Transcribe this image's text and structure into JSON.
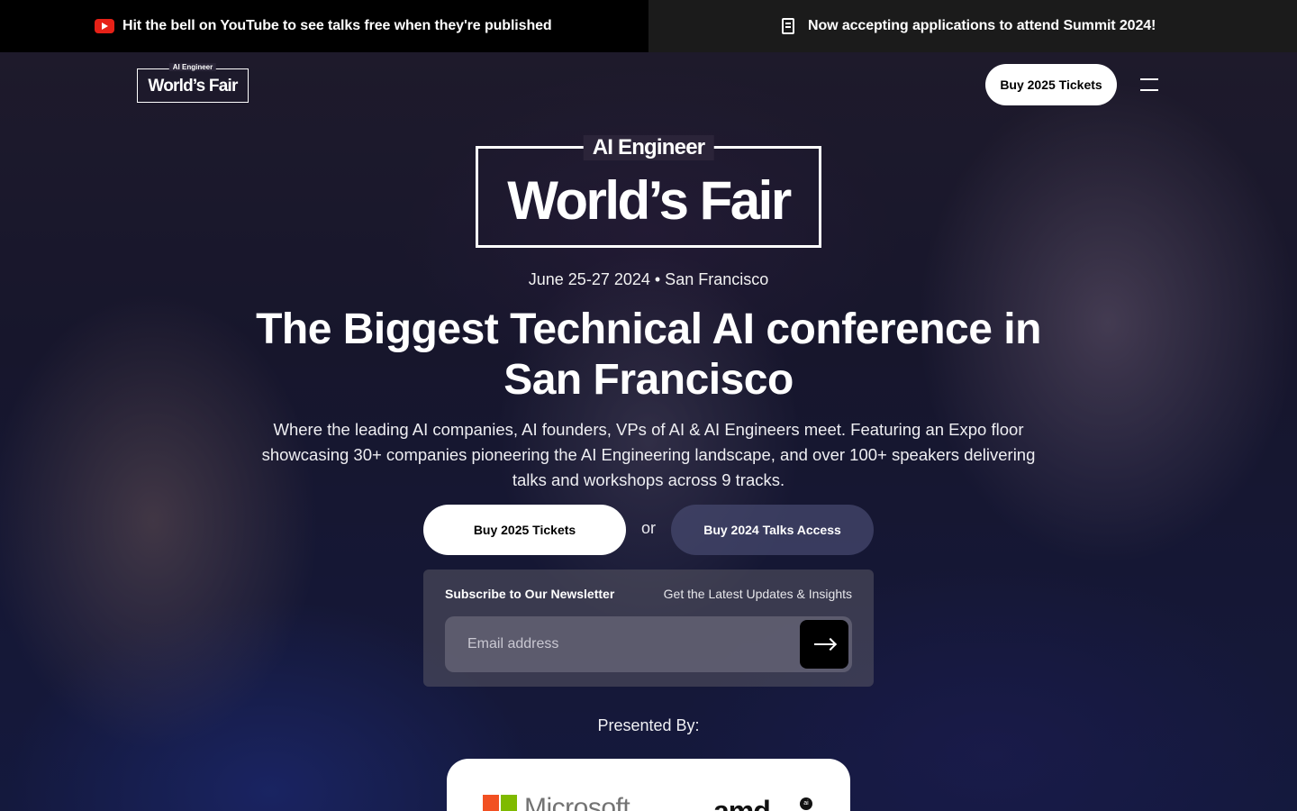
{
  "announcements": {
    "left_text": "Hit the bell on YouTube to see talks free when they're published",
    "left_icon": "youtube-icon",
    "right_text": "Now accepting applications to attend Summit 2024!",
    "right_icon": "application-icon"
  },
  "nav": {
    "logo_small": "AI Engineer",
    "logo_big": "World’s Fair",
    "buy_button": "Buy 2025 Tickets",
    "menu_icon": "hamburger-menu-icon"
  },
  "hero": {
    "logo_small": "AI Engineer",
    "logo_big": "World’s Fair",
    "dateline": "June 25-27 2024 • San Francisco",
    "headline": "The Biggest Technical AI conference in San Francisco",
    "subtext": "Where the leading AI companies, AI founders, VPs of AI & AI Engineers meet. Featuring an Expo floor showcasing 30+ companies pioneering the AI Engineering landscape, and over 100+ speakers delivering talks and workshops across 9 tracks.",
    "cta_primary": "Buy 2025 Tickets",
    "or": "or",
    "cta_secondary": "Buy 2024 Talks Access"
  },
  "newsletter": {
    "title": "Subscribe to Our Newsletter",
    "subtitle": "Get the Latest Updates & Insights",
    "placeholder": "Email address",
    "submit_icon": "arrow-right-icon"
  },
  "sponsors": {
    "heading": "Presented By:",
    "items": [
      "Microsoft",
      "amd"
    ],
    "amd_badge": "ai"
  },
  "colors": {
    "youtube_red": "#e62117",
    "topbar_left": "#000000",
    "topbar_right": "#1b1b1b"
  }
}
